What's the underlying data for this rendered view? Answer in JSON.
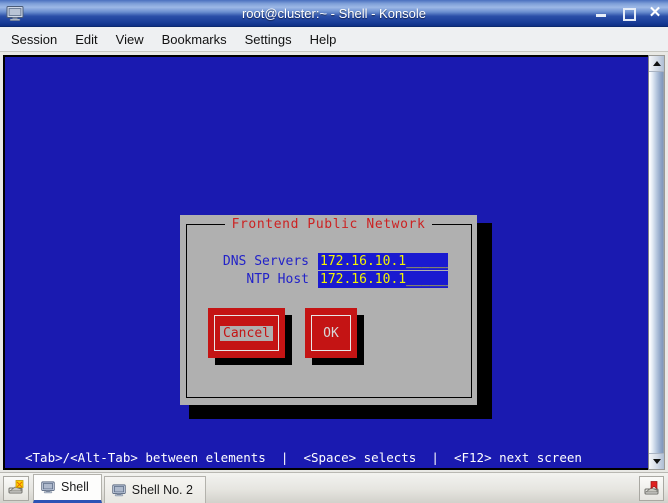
{
  "window": {
    "title": "root@cluster:~ - Shell - Konsole",
    "icon": "terminal-icon",
    "buttons": {
      "minimize": "minimize-icon",
      "maximize": "maximize-icon",
      "close": "✕"
    }
  },
  "menubar": {
    "items": [
      {
        "label": "Session"
      },
      {
        "label": "Edit"
      },
      {
        "label": "View"
      },
      {
        "label": "Bookmarks"
      },
      {
        "label": "Settings"
      },
      {
        "label": "Help"
      }
    ]
  },
  "terminal": {
    "background_color": "#1a1ab0",
    "status_line": "<Tab>/<Alt-Tab> between elements  |  <Space> selects  |  <F12> next screen"
  },
  "dialog": {
    "title": "Frontend Public Network",
    "title_color": "#cc2222",
    "background_color": "#b0b0b0",
    "fields": [
      {
        "label": "DNS Servers",
        "value": "172.16.10.1",
        "fill": "______"
      },
      {
        "label": "NTP Host",
        "value": "172.16.10.1",
        "fill": "______"
      }
    ],
    "buttons": [
      {
        "name": "cancel",
        "label": "Cancel",
        "focused": true
      },
      {
        "name": "ok",
        "label": "OK",
        "focused": false
      }
    ]
  },
  "scrollbar": {
    "up_arrow": "▲",
    "down_arrow": "▼"
  },
  "taskbar": {
    "launcher_icon": "konsole-session-icon",
    "tabs": [
      {
        "label": "Shell",
        "active": true
      },
      {
        "label": "Shell No. 2",
        "active": false
      }
    ],
    "tray_icon": "bookmark-icon"
  }
}
